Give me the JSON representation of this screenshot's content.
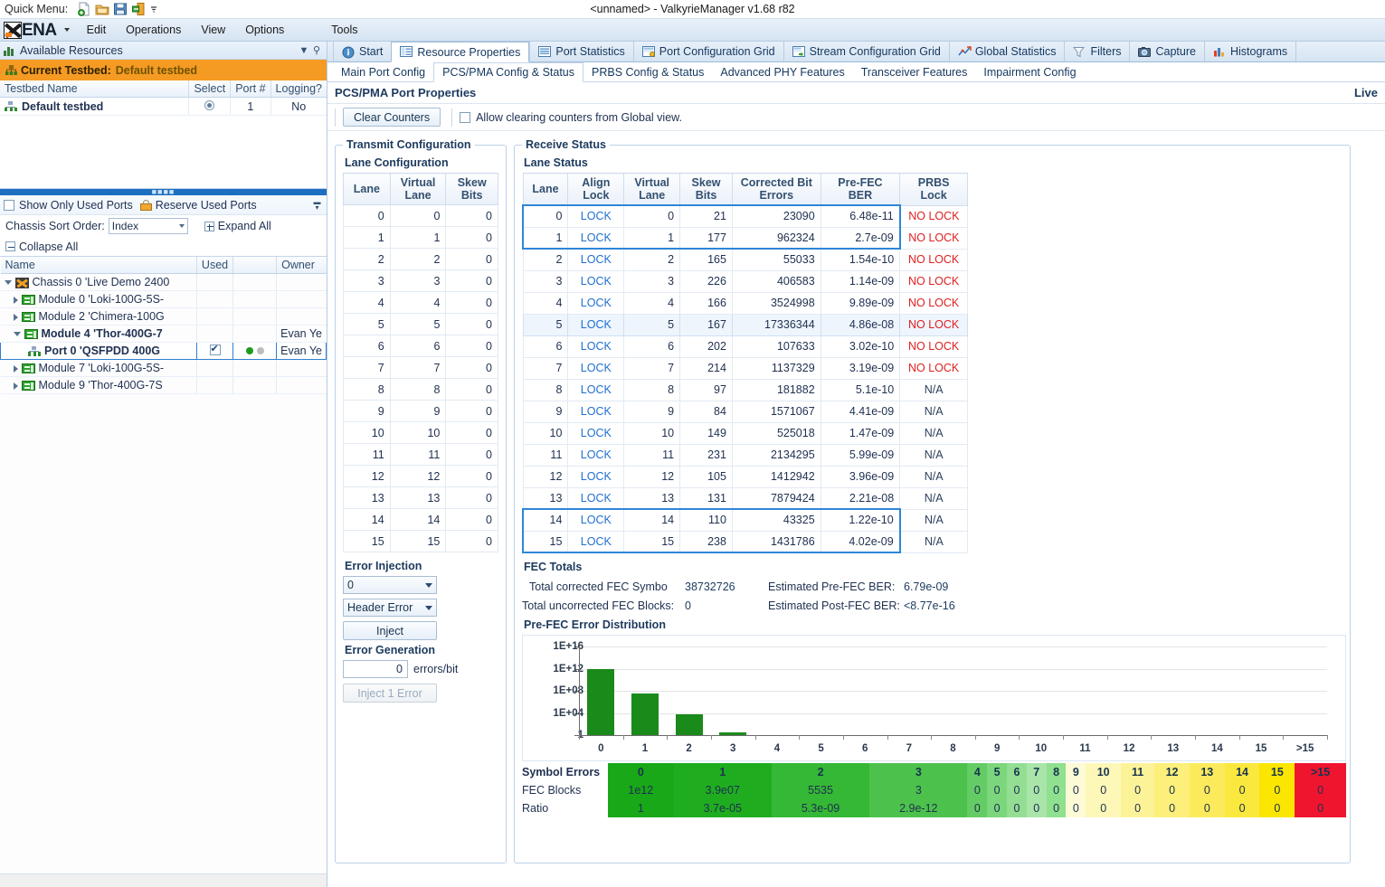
{
  "titlebar": {
    "quick_menu_label": "Quick Menu:",
    "window_title": "<unnamed> - ValkyrieManager v1.68 r82",
    "quick_icons": [
      "new-document-icon",
      "open-folder-icon",
      "save-disk-icon",
      "exit-door-icon",
      "more-overflow-icon"
    ]
  },
  "menubar": {
    "brand": "ENA",
    "items": [
      "Edit",
      "Operations",
      "View",
      "Options",
      "Tools"
    ]
  },
  "sidebar": {
    "panel_title": "Available Resources",
    "panel_icons": [
      "resources-icon",
      "chevron-down-icon",
      "pin-icon"
    ],
    "testbed_bar": {
      "label": "Current Testbed:",
      "value": "Default testbed"
    },
    "testbed_table": {
      "columns": [
        "Testbed Name",
        "Select",
        "Port #",
        "Logging?"
      ],
      "rows": [
        {
          "name": "Default testbed",
          "select": "selected",
          "ports": "1",
          "logging": "No"
        }
      ]
    },
    "ports_toolbar": {
      "show_only_used_ports": "Show Only Used Ports",
      "show_only_used_checked": false,
      "reserve_used_ports": "Reserve Used Ports",
      "chassis_sort_label": "Chassis Sort Order:",
      "chassis_sort_value": "Index",
      "expand_all": "Expand All",
      "collapse_all": "Collapse All"
    },
    "tree_table": {
      "columns": [
        "Name",
        "Used",
        "",
        "Owner"
      ],
      "rows": [
        {
          "indent": 0,
          "expander": "open",
          "icon": "chassis-icon",
          "name": "Chassis 0 'Live Demo 2400",
          "used": "",
          "leds": false,
          "owner": "",
          "bold": false,
          "selected": false
        },
        {
          "indent": 1,
          "expander": "closed",
          "icon": "module-icon",
          "name": "Module 0 'Loki-100G-5S-",
          "used": "",
          "leds": false,
          "owner": "",
          "bold": false,
          "selected": false
        },
        {
          "indent": 1,
          "expander": "closed",
          "icon": "module-icon",
          "name": "Module 2 'Chimera-100G",
          "used": "",
          "leds": false,
          "owner": "",
          "bold": false,
          "selected": false
        },
        {
          "indent": 1,
          "expander": "open",
          "icon": "module-icon",
          "name": "Module 4 'Thor-400G-7",
          "used": "",
          "leds": false,
          "owner": "Evan Ye",
          "bold": true,
          "selected": false
        },
        {
          "indent": 2,
          "expander": "none",
          "icon": "port-icon",
          "name": "Port 0 'QSFPDD 400G",
          "used": "checked",
          "leds": true,
          "owner": "Evan Ye",
          "bold": true,
          "selected": true
        },
        {
          "indent": 1,
          "expander": "closed",
          "icon": "module-icon",
          "name": "Module 7 'Loki-100G-5S-",
          "used": "",
          "leds": false,
          "owner": "",
          "bold": false,
          "selected": false
        },
        {
          "indent": 1,
          "expander": "closed",
          "icon": "module-icon",
          "name": "Module 9 'Thor-400G-7S",
          "used": "",
          "leds": false,
          "owner": "",
          "bold": false,
          "selected": false
        }
      ]
    }
  },
  "main_tabs": [
    {
      "label": "Start",
      "icon": "info-circle-icon",
      "active": false
    },
    {
      "label": "Resource Properties",
      "icon": "properties-grid-icon",
      "active": true
    },
    {
      "label": "Port Statistics",
      "icon": "list-lines-icon",
      "active": false
    },
    {
      "label": "Port Configuration Grid",
      "icon": "config-grid-icon",
      "active": false
    },
    {
      "label": "Stream Configuration Grid",
      "icon": "stream-grid-icon",
      "active": false
    },
    {
      "label": "Global Statistics",
      "icon": "trend-chart-icon",
      "active": false
    },
    {
      "label": "Filters",
      "icon": "funnel-icon",
      "active": false
    },
    {
      "label": "Capture",
      "icon": "camera-icon",
      "active": false
    },
    {
      "label": "Histograms",
      "icon": "bar-chart-icon",
      "active": false
    }
  ],
  "sub_tabs": [
    {
      "label": "Main Port Config",
      "active": false
    },
    {
      "label": "PCS/PMA Config & Status",
      "active": true
    },
    {
      "label": "PRBS Config & Status",
      "active": false
    },
    {
      "label": "Advanced PHY Features",
      "active": false
    },
    {
      "label": "Transceiver Features",
      "active": false
    },
    {
      "label": "Impairment Config",
      "active": false
    }
  ],
  "page": {
    "title": "PCS/PMA Port Properties",
    "live_label": "Live",
    "clear_counters_button": "Clear Counters",
    "allow_clearing_label": "Allow clearing counters from Global view.",
    "allow_clearing_checked": false
  },
  "transmit": {
    "group_title": "Transmit Configuration",
    "lane_config_title": "Lane Configuration",
    "columns": [
      "Lane",
      "Virtual Lane",
      "Skew Bits"
    ],
    "rows": [
      [
        "0",
        "0",
        "0"
      ],
      [
        "1",
        "1",
        "0"
      ],
      [
        "2",
        "2",
        "0"
      ],
      [
        "3",
        "3",
        "0"
      ],
      [
        "4",
        "4",
        "0"
      ],
      [
        "5",
        "5",
        "0"
      ],
      [
        "6",
        "6",
        "0"
      ],
      [
        "7",
        "7",
        "0"
      ],
      [
        "8",
        "8",
        "0"
      ],
      [
        "9",
        "9",
        "0"
      ],
      [
        "10",
        "10",
        "0"
      ],
      [
        "11",
        "11",
        "0"
      ],
      [
        "12",
        "12",
        "0"
      ],
      [
        "13",
        "13",
        "0"
      ],
      [
        "14",
        "14",
        "0"
      ],
      [
        "15",
        "15",
        "0"
      ]
    ],
    "error_injection_title": "Error Injection",
    "injection_lane_value": "0",
    "injection_type_value": "Header Error",
    "inject_button": "Inject",
    "error_generation_title": "Error Generation",
    "error_rate_value": "0",
    "error_rate_unit": "errors/bit",
    "inject_one_button": "Inject 1 Error"
  },
  "receive": {
    "group_title": "Receive Status",
    "lane_status_title": "Lane Status",
    "columns": [
      "Lane",
      "Align Lock",
      "Virtual Lane",
      "Skew Bits",
      "Corrected Bit Errors",
      "Pre-FEC BER",
      "PRBS Lock"
    ],
    "rows": [
      {
        "lane": "0",
        "align": "LOCK",
        "vlane": "0",
        "skew": "21",
        "corrected": "23090",
        "ber": "6.48e-11",
        "prbs": "NO LOCK"
      },
      {
        "lane": "1",
        "align": "LOCK",
        "vlane": "1",
        "skew": "177",
        "corrected": "962324",
        "ber": "2.7e-09",
        "prbs": "NO LOCK"
      },
      {
        "lane": "2",
        "align": "LOCK",
        "vlane": "2",
        "skew": "165",
        "corrected": "55033",
        "ber": "1.54e-10",
        "prbs": "NO LOCK"
      },
      {
        "lane": "3",
        "align": "LOCK",
        "vlane": "3",
        "skew": "226",
        "corrected": "406583",
        "ber": "1.14e-09",
        "prbs": "NO LOCK"
      },
      {
        "lane": "4",
        "align": "LOCK",
        "vlane": "4",
        "skew": "166",
        "corrected": "3524998",
        "ber": "9.89e-09",
        "prbs": "NO LOCK"
      },
      {
        "lane": "5",
        "align": "LOCK",
        "vlane": "5",
        "skew": "167",
        "corrected": "17336344",
        "ber": "4.86e-08",
        "prbs": "NO LOCK"
      },
      {
        "lane": "6",
        "align": "LOCK",
        "vlane": "6",
        "skew": "202",
        "corrected": "107633",
        "ber": "3.02e-10",
        "prbs": "NO LOCK"
      },
      {
        "lane": "7",
        "align": "LOCK",
        "vlane": "7",
        "skew": "214",
        "corrected": "1137329",
        "ber": "3.19e-09",
        "prbs": "NO LOCK"
      },
      {
        "lane": "8",
        "align": "LOCK",
        "vlane": "8",
        "skew": "97",
        "corrected": "181882",
        "ber": "5.1e-10",
        "prbs": "N/A"
      },
      {
        "lane": "9",
        "align": "LOCK",
        "vlane": "9",
        "skew": "84",
        "corrected": "1571067",
        "ber": "4.41e-09",
        "prbs": "N/A"
      },
      {
        "lane": "10",
        "align": "LOCK",
        "vlane": "10",
        "skew": "149",
        "corrected": "525018",
        "ber": "1.47e-09",
        "prbs": "N/A"
      },
      {
        "lane": "11",
        "align": "LOCK",
        "vlane": "11",
        "skew": "231",
        "corrected": "2134295",
        "ber": "5.99e-09",
        "prbs": "N/A"
      },
      {
        "lane": "12",
        "align": "LOCK",
        "vlane": "12",
        "skew": "105",
        "corrected": "1412942",
        "ber": "3.96e-09",
        "prbs": "N/A"
      },
      {
        "lane": "13",
        "align": "LOCK",
        "vlane": "13",
        "skew": "131",
        "corrected": "7879424",
        "ber": "2.21e-08",
        "prbs": "N/A"
      },
      {
        "lane": "14",
        "align": "LOCK",
        "vlane": "14",
        "skew": "110",
        "corrected": "43325",
        "ber": "1.22e-10",
        "prbs": "N/A"
      },
      {
        "lane": "15",
        "align": "LOCK",
        "vlane": "15",
        "skew": "238",
        "corrected": "1431786",
        "ber": "4.02e-09",
        "prbs": "N/A"
      }
    ],
    "hover_row_index": 5,
    "selection_boxes": [
      [
        0,
        1
      ],
      [
        14,
        15
      ]
    ],
    "fec_totals": {
      "title": "FEC Totals",
      "corrected_symbols_label": "Total corrected FEC Symbo",
      "corrected_symbols_value": "38732726",
      "uncorrected_blocks_label": "Total uncorrected FEC Blocks:",
      "uncorrected_blocks_value": "0",
      "pre_fec_ber_label": "Estimated Pre-FEC BER:",
      "pre_fec_ber_value": "6.79e-09",
      "post_fec_ber_label": "Estimated Post-FEC BER:",
      "post_fec_ber_value": "<8.77e-16"
    },
    "distribution_title": "Pre-FEC Error Distribution",
    "heat_labels": [
      "Symbol Errors",
      "FEC Blocks",
      "Ratio"
    ]
  },
  "chart_data": {
    "type": "bar",
    "title": "Pre-FEC Error Distribution",
    "xlabel": "",
    "ylabel": "",
    "log_scale": true,
    "grid": true,
    "legend": "none",
    "categories": [
      "0",
      "1",
      "2",
      "3",
      "4",
      "5",
      "6",
      "7",
      "8",
      "9",
      "10",
      "11",
      "12",
      "13",
      "14",
      "15",
      ">15"
    ],
    "ytick_labels": [
      "1E+16",
      "1E+12",
      "1E+08",
      "1E+04",
      "1"
    ],
    "ytick_values": [
      1e+16,
      1000000000000.0,
      100000000.0,
      10000.0,
      1
    ],
    "ylim": [
      1,
      1e+16
    ],
    "values": [
      1000000000000.0,
      39000000.0,
      5535,
      3,
      0,
      0,
      0,
      0,
      0,
      0,
      0,
      0,
      0,
      0,
      0,
      0,
      0
    ],
    "bar_color": "#1a8a1a",
    "series": [
      {
        "name": "FEC Blocks",
        "values": [
          1000000000000.0,
          39000000.0,
          5535,
          3,
          0,
          0,
          0,
          0,
          0,
          0,
          0,
          0,
          0,
          0,
          0,
          0,
          0
        ]
      }
    ],
    "table": {
      "row_labels": [
        "Symbol Errors",
        "FEC Blocks",
        "Ratio"
      ],
      "symbol_errors": [
        "0",
        "1",
        "2",
        "3",
        "4",
        "5",
        "6",
        "7",
        "8",
        "9",
        "10",
        "11",
        "12",
        "13",
        "14",
        "15",
        ">15"
      ],
      "fec_blocks": [
        "1e12",
        "3.9e07",
        "5535",
        "3",
        "0",
        "0",
        "0",
        "0",
        "0",
        "0",
        "0",
        "0",
        "0",
        "0",
        "0",
        "0",
        "0"
      ],
      "ratio": [
        "1",
        "3.7e-05",
        "5.3e-09",
        "2.9e-12",
        "0",
        "0",
        "0",
        "0",
        "0",
        "0",
        "0",
        "0",
        "0",
        "0",
        "0",
        "0",
        "0"
      ],
      "cell_colors": [
        "#18a818",
        "#1fad1f",
        "#35b835",
        "#4cc24c",
        "#64cc64",
        "#7cd67c",
        "#93de93",
        "#a9e5a9",
        "#8fe08f",
        "#fdfbd6",
        "#fdf7b8",
        "#fcf399",
        "#fcef7a",
        "#fbeb5c",
        "#fbe83e",
        "#fae600",
        "#f0152f"
      ]
    }
  }
}
